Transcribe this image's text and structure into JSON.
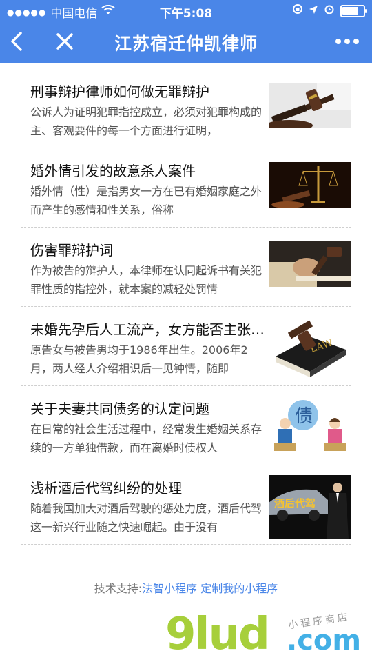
{
  "status_bar": {
    "signal_dots": "●●●●●",
    "carrier": "中国电信",
    "wifi_icon": "wifi-icon",
    "time": "下午5:08",
    "battery_level": 0.9
  },
  "nav": {
    "title": "江苏宿迁仲凯律师",
    "back_icon": "back-icon",
    "close_icon": "close-icon",
    "more_icon": "more-icon"
  },
  "articles": [
    {
      "title": "刑事辩护律师如何做无罪辩护",
      "summary": "公诉人为证明犯罪指控成立，必须对犯罪构成的主、客观要件的每一个方面进行证明，",
      "thumb": "gavel-image"
    },
    {
      "title": "婚外情引发的故意杀人案件",
      "summary": "婚外情（性）是指男女一方在已有婚姻家庭之外而产生的感情和性关系，俗称",
      "thumb": "scales-image"
    },
    {
      "title": "伤害罪辩护词",
      "summary": "作为被告的辩护人，本律师在认同起诉书有关犯罪性质的指控外，就本案的减轻处罚情",
      "thumb": "gavel-hand-image"
    },
    {
      "title": "未婚先孕后人工流产，女方能否主张…",
      "summary": "原告女与被告男均于1986年出生。2006年2月，两人经人介绍相识后一见钟情，随即",
      "thumb": "law-book-image"
    },
    {
      "title": "关于夫妻共同债务的认定问题",
      "summary": "在日常的社会生活过程中，经常发生婚姻关系存续的一方单独借款，而在离婚时债权人",
      "thumb": "debt-cartoon-image"
    },
    {
      "title": "浅析酒后代驾纠纷的处理",
      "summary": "随着我国加大对酒后驾驶的惩处力度，酒后代驾这一新兴行业随之快速崛起。由于没有",
      "thumb": "designated-driver-image",
      "thumb_caption": "酒后代驾"
    }
  ],
  "footer": {
    "prefix": "技术支持:",
    "provider": "法智小程序",
    "customize": "定制我的小程序"
  },
  "watermark": {
    "brand": "9lud",
    "domain": ".com",
    "tagline": "小程序商店"
  },
  "colors": {
    "nav_bg": "#4a86e8",
    "link": "#4a86e8",
    "watermark_green": "#a7cf3b",
    "watermark_blue": "#43b0e6"
  }
}
